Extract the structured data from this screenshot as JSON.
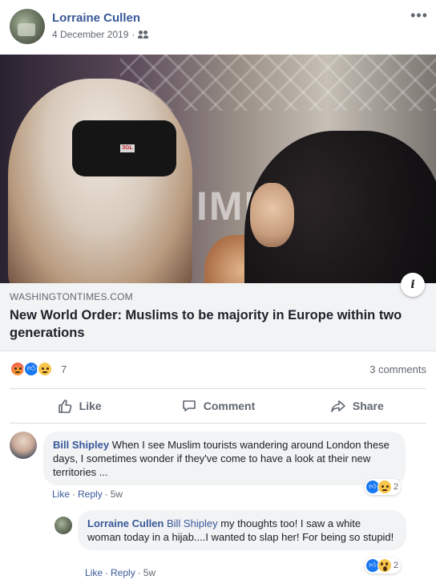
{
  "post": {
    "author": "Lorraine Cullen",
    "date": "4 December 2019",
    "privacy_icon": "friends-icon",
    "more_icon": "more-options-icon"
  },
  "link_preview": {
    "domain": "WASHINGTONTIMES.COM",
    "title": "New World Order: Muslims to be majority in Europe within two generations",
    "image_text": "IMM",
    "headset_label": "3GL",
    "info_icon_glyph": "i"
  },
  "reactions": {
    "types": [
      "angry",
      "like",
      "sad"
    ],
    "count": "7",
    "comments": "3 comments"
  },
  "actions": {
    "like": "Like",
    "comment": "Comment",
    "share": "Share"
  },
  "comments": [
    {
      "author": "Bill Shipley",
      "text": "When I see Muslim tourists wandering around London these days, I sometimes wonder if they've come to have a look at their new territories ...",
      "like": "Like",
      "reply": "Reply",
      "time": "5w",
      "reactions": [
        "like",
        "sad"
      ],
      "reaction_count": "2"
    },
    {
      "author": "Lorraine Cullen",
      "mention": "Bill Shipley",
      "text": "my thoughts too! I saw a white woman today in a hijab....I wanted to slap her! For being so stupid!",
      "like": "Like",
      "reply": "Reply",
      "time": "5w",
      "reactions": [
        "like",
        "wow"
      ],
      "reaction_count": "2"
    }
  ],
  "colors": {
    "link_blue": "#385898",
    "meta_gray": "#606770",
    "bubble_bg": "#f2f3f5",
    "like_blue": "#1877f2"
  }
}
